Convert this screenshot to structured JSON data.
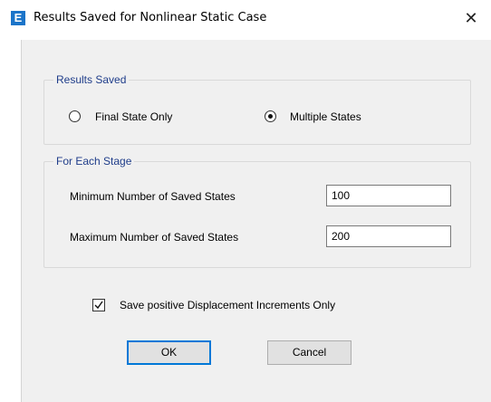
{
  "window": {
    "title": "Results Saved for Nonlinear Static Case",
    "app_icon_letter": "E",
    "close_glyph": "✕"
  },
  "results_saved": {
    "legend": "Results Saved",
    "option_final": "Final State Only",
    "option_multiple": "Multiple States",
    "selected": "Multiple States"
  },
  "each_stage": {
    "legend": "For Each Stage",
    "min_label": "Minimum Number of Saved States",
    "min_value": "100",
    "max_label": "Maximum Number of Saved States",
    "max_value": "200"
  },
  "options": {
    "positive_only_label": "Save positive Displacement Increments Only",
    "positive_only_checked": true
  },
  "buttons": {
    "ok": "OK",
    "cancel": "Cancel"
  },
  "colors": {
    "accent": "#0078d7",
    "legend_text": "#1f3d8a",
    "app_icon": "#1b74c9"
  }
}
